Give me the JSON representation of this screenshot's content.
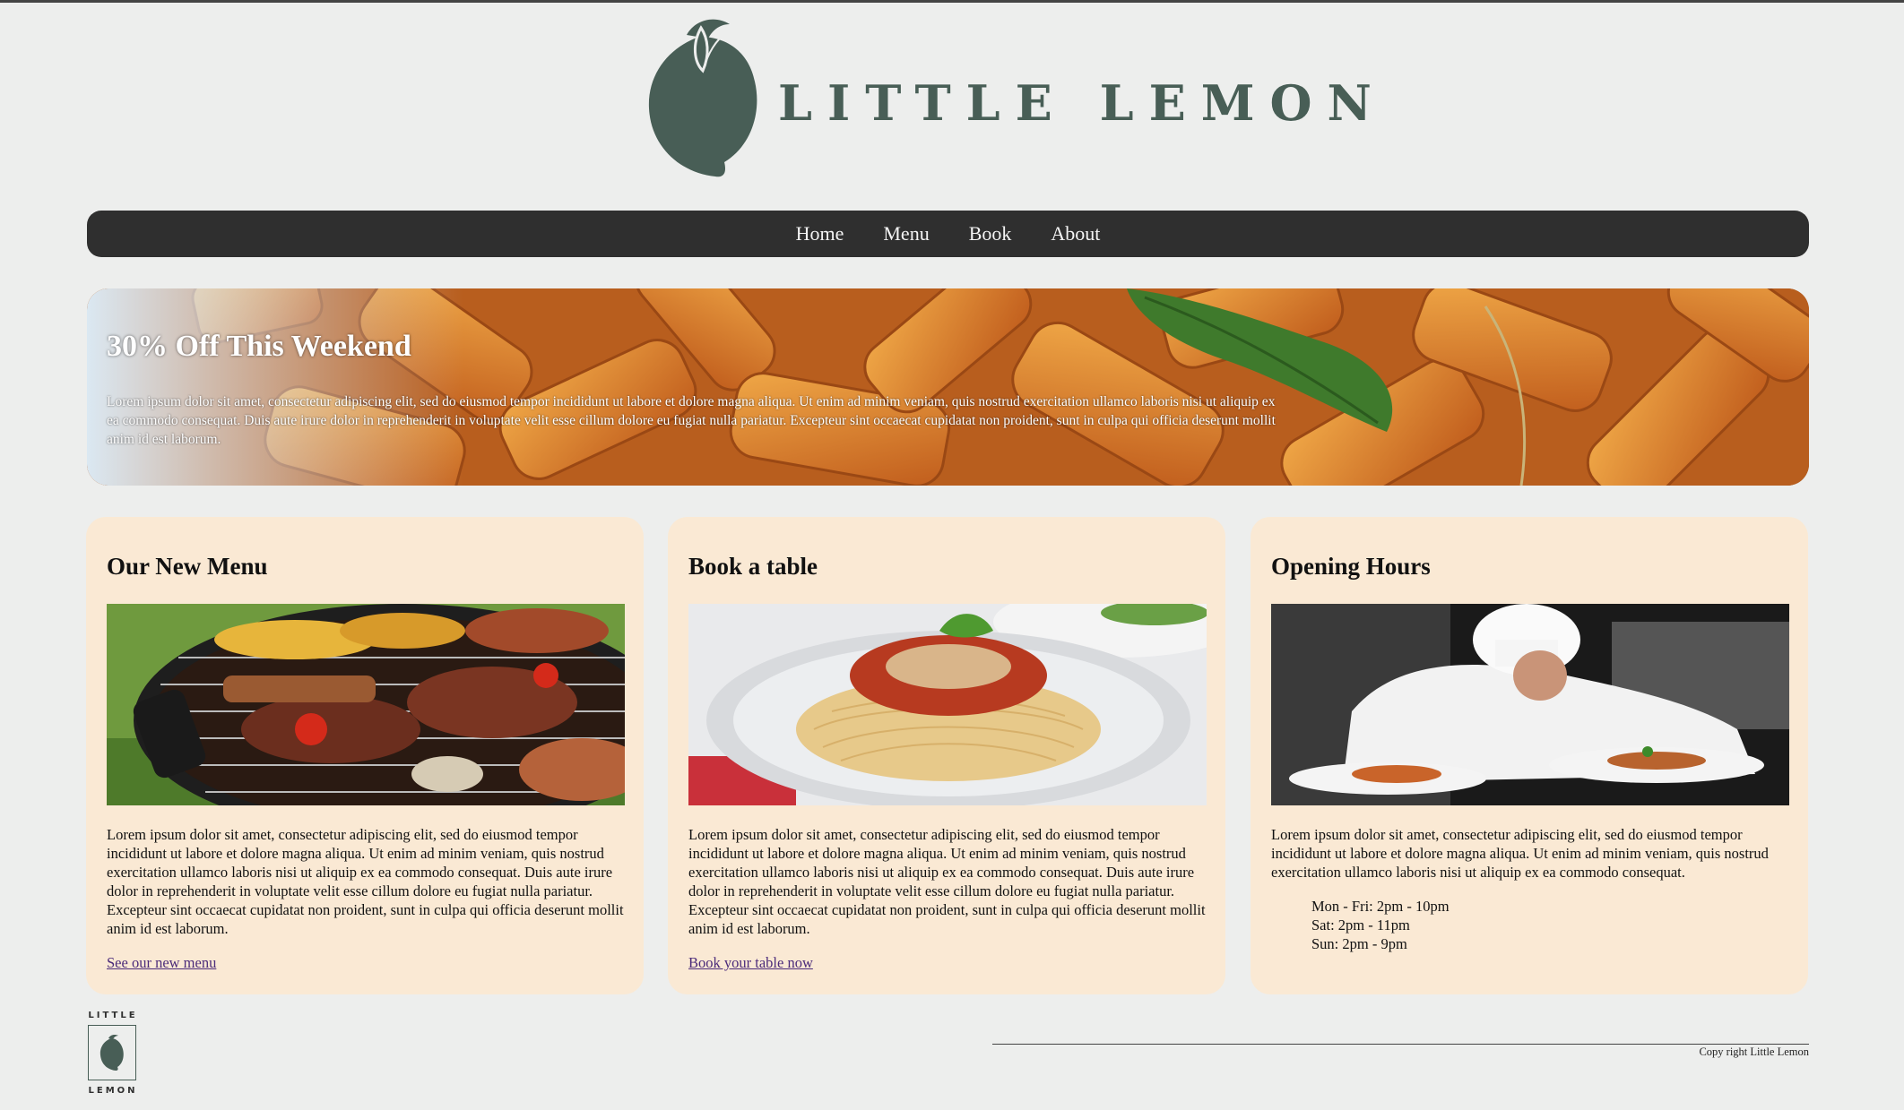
{
  "brand": {
    "name": "LITTLE LEMON"
  },
  "nav": {
    "items": [
      {
        "label": "Home"
      },
      {
        "label": "Menu"
      },
      {
        "label": "Book"
      },
      {
        "label": "About"
      }
    ]
  },
  "promo": {
    "title": "30% Off This Weekend",
    "text": "Lorem ipsum dolor sit amet, consectetur adipiscing elit, sed do eiusmod tempor incididunt ut labore et dolore magna aliqua. Ut enim ad minim veniam, quis nostrud exercitation ullamco laboris nisi ut aliquip ex ea commodo consequat. Duis aute irure dolor in reprehenderit in voluptate velit esse cillum dolore eu fugiat nulla pariatur. Excepteur sint occaecat cupidatat non proident, sunt in culpa qui officia deserunt mollit anim id est laborum."
  },
  "cards": [
    {
      "title": "Our New Menu",
      "text": "Lorem ipsum dolor sit amet, consectetur adipiscing elit, sed do eiusmod tempor incididunt ut labore et dolore magna aliqua. Ut enim ad minim veniam, quis nostrud exercitation ullamco laboris nisi ut aliquip ex ea commodo consequat. Duis aute irure dolor in reprehenderit in voluptate velit esse cillum dolore eu fugiat nulla pariatur. Excepteur sint occaecat cupidatat non proident, sunt in culpa qui officia deserunt mollit anim id est laborum.",
      "link": "See our new menu"
    },
    {
      "title": "Book a table",
      "text": "Lorem ipsum dolor sit amet, consectetur adipiscing elit, sed do eiusmod tempor incididunt ut labore et dolore magna aliqua. Ut enim ad minim veniam, quis nostrud exercitation ullamco laboris nisi ut aliquip ex ea commodo consequat. Duis aute irure dolor in reprehenderit in voluptate velit esse cillum dolore eu fugiat nulla pariatur. Excepteur sint occaecat cupidatat non proident, sunt in culpa qui officia deserunt mollit anim id est laborum.",
      "link": "Book your table now"
    },
    {
      "title": "Opening Hours",
      "text": "Lorem ipsum dolor sit amet, consectetur adipiscing elit, sed do eiusmod tempor incididunt ut labore et dolore magna aliqua. Ut enim ad minim veniam, quis nostrud exercitation ullamco laboris nisi ut aliquip ex ea commodo consequat.",
      "hours": [
        "Mon - Fri: 2pm - 10pm",
        "Sat: 2pm - 11pm",
        "Sun: 2pm - 9pm"
      ]
    }
  ],
  "footer": {
    "logo_top": "LITTLE",
    "logo_bottom": "LEMON",
    "copyright": "Copy right Little Lemon"
  },
  "colors": {
    "brand_green": "#485e56",
    "nav_bg": "#2f2f2f",
    "card_bg": "#fae9d4",
    "page_bg": "#edeeed"
  },
  "icons": {
    "logo": "lemon-icon",
    "footer_logo": "lemon-icon"
  }
}
